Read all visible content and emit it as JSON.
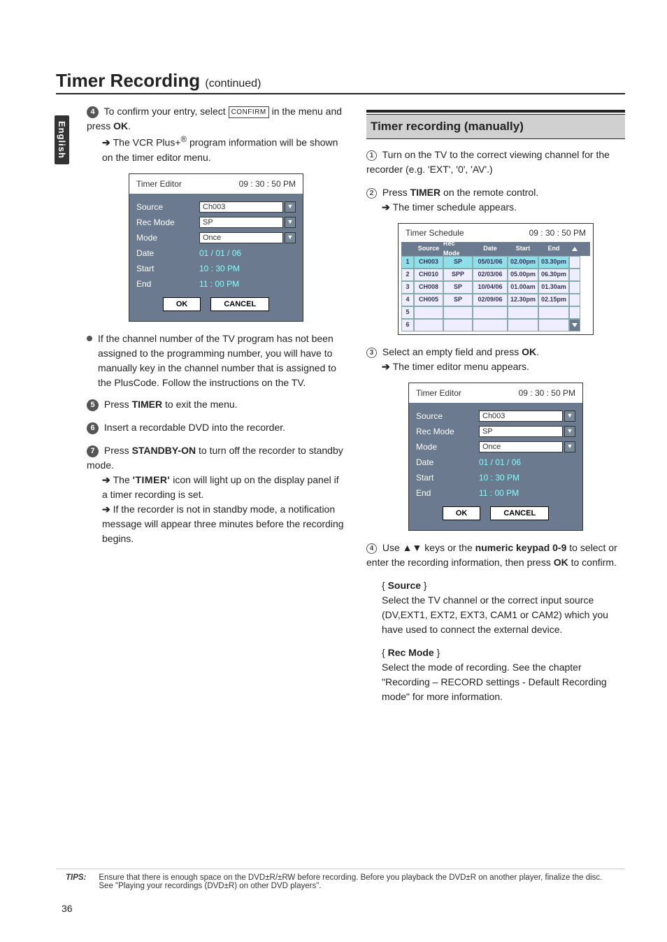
{
  "title": "Timer Recording ",
  "title_cont": "(continued)",
  "side_tab": "English",
  "left": {
    "step4_a": "To confirm your entry, select ",
    "confirm_box": "CONFIRM",
    "step4_b": " in the menu and press ",
    "ok": "OK",
    "step4_c": ".",
    "step4_arrow": "The VCR Plus+",
    "step4_arrow_sup": "®",
    "step4_arrow2": " program information will be shown on the timer editor menu.",
    "editor": {
      "title": "Timer Editor",
      "clock": "09 : 30 : 50 PM",
      "rows": {
        "source_label": "Source",
        "source_val": "Ch003",
        "rec_label": "Rec Mode",
        "rec_val": "SP",
        "mode_label": "Mode",
        "mode_val": "Once",
        "date_label": "Date",
        "date_val": "01 / 01 / 06",
        "start_label": "Start",
        "start_val": "10 : 30 PM",
        "end_label": "End",
        "end_val": "11 : 00 PM"
      },
      "ok_btn": "OK",
      "cancel_btn": "CANCEL"
    },
    "bullet": "If the channel number of the TV program has not been assigned to the programming number, you will have to manually key in the channel number that is assigned to the PlusCode. Follow the instructions on the TV.",
    "step5_a": "Press ",
    "step5_b": "TIMER",
    "step5_c": " to exit the menu.",
    "step6": "Insert a recordable DVD into the recorder.",
    "step7_a": "Press ",
    "step7_b": "STANDBY-ON",
    "step7_c": " to turn off the recorder to standby mode.",
    "step7_arrow1_a": "The ",
    "step7_arrow1_b": "'TIMER'",
    "step7_arrow1_c": " icon will light up on the display panel if a timer recording is set.",
    "step7_arrow2": "If the recorder is not in standby mode, a notification message will appear three minutes before the recording begins."
  },
  "right": {
    "section": "Timer recording (manually)",
    "step1": "Turn on the TV to the correct viewing channel for the recorder (e.g. 'EXT', '0', 'AV'.)",
    "step2_a": "Press ",
    "step2_b": "TIMER",
    "step2_c": " on the remote control.",
    "step2_arrow": "The timer schedule appears.",
    "schedule": {
      "title": "Timer Schedule",
      "clock": "09 : 30 : 50 PM",
      "headers": {
        "source": "Source",
        "rec": "Rec Mode",
        "date": "Date",
        "start": "Start",
        "end": "End"
      },
      "rows": [
        {
          "idx": "1",
          "src": "CH003",
          "rm": "SP",
          "dt": "05/01/06",
          "st": "02.00pm",
          "en": "03.30pm"
        },
        {
          "idx": "2",
          "src": "CH010",
          "rm": "SPP",
          "dt": "02/03/06",
          "st": "05.00pm",
          "en": "06.30pm"
        },
        {
          "idx": "3",
          "src": "CH008",
          "rm": "SP",
          "dt": "10/04/06",
          "st": "01.00am",
          "en": "01.30am"
        },
        {
          "idx": "4",
          "src": "CH005",
          "rm": "SP",
          "dt": "02/09/06",
          "st": "12.30pm",
          "en": "02.15pm"
        },
        {
          "idx": "5",
          "src": "",
          "rm": "",
          "dt": "",
          "st": "",
          "en": ""
        },
        {
          "idx": "6",
          "src": "",
          "rm": "",
          "dt": "",
          "st": "",
          "en": ""
        }
      ]
    },
    "step3_a": "Select an empty field and press ",
    "step3_b": "OK",
    "step3_c": ".",
    "step3_arrow": "The timer editor menu appears.",
    "editor": {
      "title": "Timer Editor",
      "clock": "09 : 30 : 50 PM",
      "rows": {
        "source_label": "Source",
        "source_val": "Ch003",
        "rec_label": "Rec Mode",
        "rec_val": "SP",
        "mode_label": "Mode",
        "mode_val": "Once",
        "date_label": "Date",
        "date_val": "01 / 01 / 06",
        "start_label": "Start",
        "start_val": "10 : 30 PM",
        "end_label": "End",
        "end_val": "11 : 00 PM"
      },
      "ok_btn": "OK",
      "cancel_btn": "CANCEL"
    },
    "step4_a": "Use ▲▼ keys or the ",
    "step4_b": "numeric keypad 0-9",
    "step4_c": " to select or enter the recording information, then press ",
    "step4_d": "OK",
    "step4_e": " to confirm.",
    "source_head": "Source",
    "source_body": "Select the TV channel or the correct input source (DV,EXT1, EXT2, EXT3, CAM1 or CAM2) which you have used to connect the external device.",
    "rec_head": "Rec Mode",
    "rec_body": "Select the mode of recording. See the chapter \"Recording – RECORD settings - Default Recording mode\" for more information."
  },
  "tips_label": "TIPS:",
  "tips_body": "Ensure that there is enough space on the DVD±R/±RW before recording. Before you playback the DVD±R on another player, finalize the disc. See \"Playing your recordings (DVD±R) on other DVD players\".",
  "page_num": "36"
}
